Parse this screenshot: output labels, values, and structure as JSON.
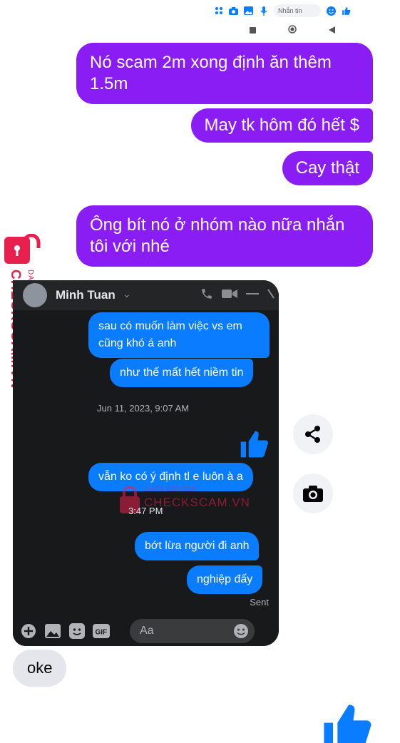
{
  "composer": {
    "placeholder": "Nhắn tin",
    "icons": [
      "apps-icon",
      "camera-icon",
      "image-icon",
      "microphone-icon",
      "emoji-icon",
      "thumbs-up-icon"
    ]
  },
  "system_nav": [
    "square-icon",
    "circle-icon",
    "back-triangle-icon"
  ],
  "messages_outgoing": [
    {
      "text": "Nó scam 2m xong định ăn thêm 1.5m"
    },
    {
      "text": "May tk hôm đó hết $"
    },
    {
      "text": "Cay thật"
    },
    {
      "text": "Ông bít nó ở nhóm nào nữa nhắn tôi với nhé"
    }
  ],
  "watermark": {
    "brand": "CHECKSCAM.VN",
    "sub": "DATA CENTER"
  },
  "screenshot": {
    "contact_name": "Minh Tuan",
    "messages": [
      {
        "text": "sau có muốn làm việc vs em cũng khó á anh"
      },
      {
        "text": "như thế mất hết niềm tin"
      },
      {
        "text": "vẫn ko có ý định tl e luôn à a"
      },
      {
        "text": "bớt lừa người đi anh"
      },
      {
        "text": "nghiệp đấy"
      }
    ],
    "timestamp_1": "Jun 11, 2023, 9:07 AM",
    "timestamp_2": "3:47 PM",
    "status": "Sent",
    "composer_placeholder": "Aa"
  },
  "message_incoming": {
    "text": "oke"
  },
  "colors": {
    "outgoing_bubble": "#8a1cf4",
    "screenshot_bubble": "#0a7cff",
    "incoming_bubble": "#e4e6eb",
    "messenger_blue": "#0a7cff",
    "watermark_red": "#e8204d"
  }
}
